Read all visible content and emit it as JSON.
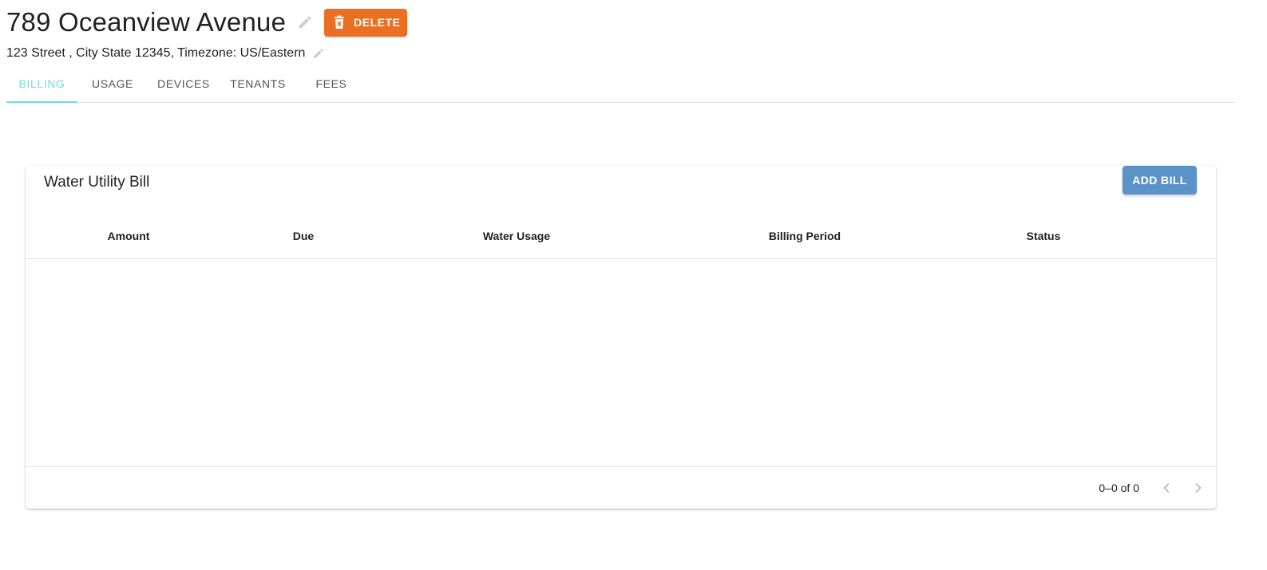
{
  "header": {
    "title": "789 Oceanview Avenue",
    "delete_label": "DELETE",
    "address": "123 Street , City State 12345, Timezone: US/Eastern"
  },
  "tabs": [
    {
      "label": "BILLING",
      "active": true
    },
    {
      "label": "USAGE",
      "active": false
    },
    {
      "label": "DEVICES",
      "active": false
    },
    {
      "label": "TENANTS",
      "active": false
    },
    {
      "label": "FEES",
      "active": false
    }
  ],
  "card": {
    "title": "Water Utility Bill",
    "add_button_label": "ADD BILL",
    "columns": [
      "Amount",
      "Due",
      "Water Usage",
      "Billing Period",
      "Status"
    ],
    "rows": [],
    "pagination": {
      "range_label": "0–0 of 0"
    }
  },
  "colors": {
    "delete_button": "#ea6f23",
    "add_button": "#5b93c9",
    "active_tab": "#6ee0d0"
  },
  "icons": {
    "title_edit": "pencil-icon",
    "address_edit": "pencil-icon",
    "delete": "trash-icon",
    "prev_page": "chevron-left-icon",
    "next_page": "chevron-right-icon"
  }
}
